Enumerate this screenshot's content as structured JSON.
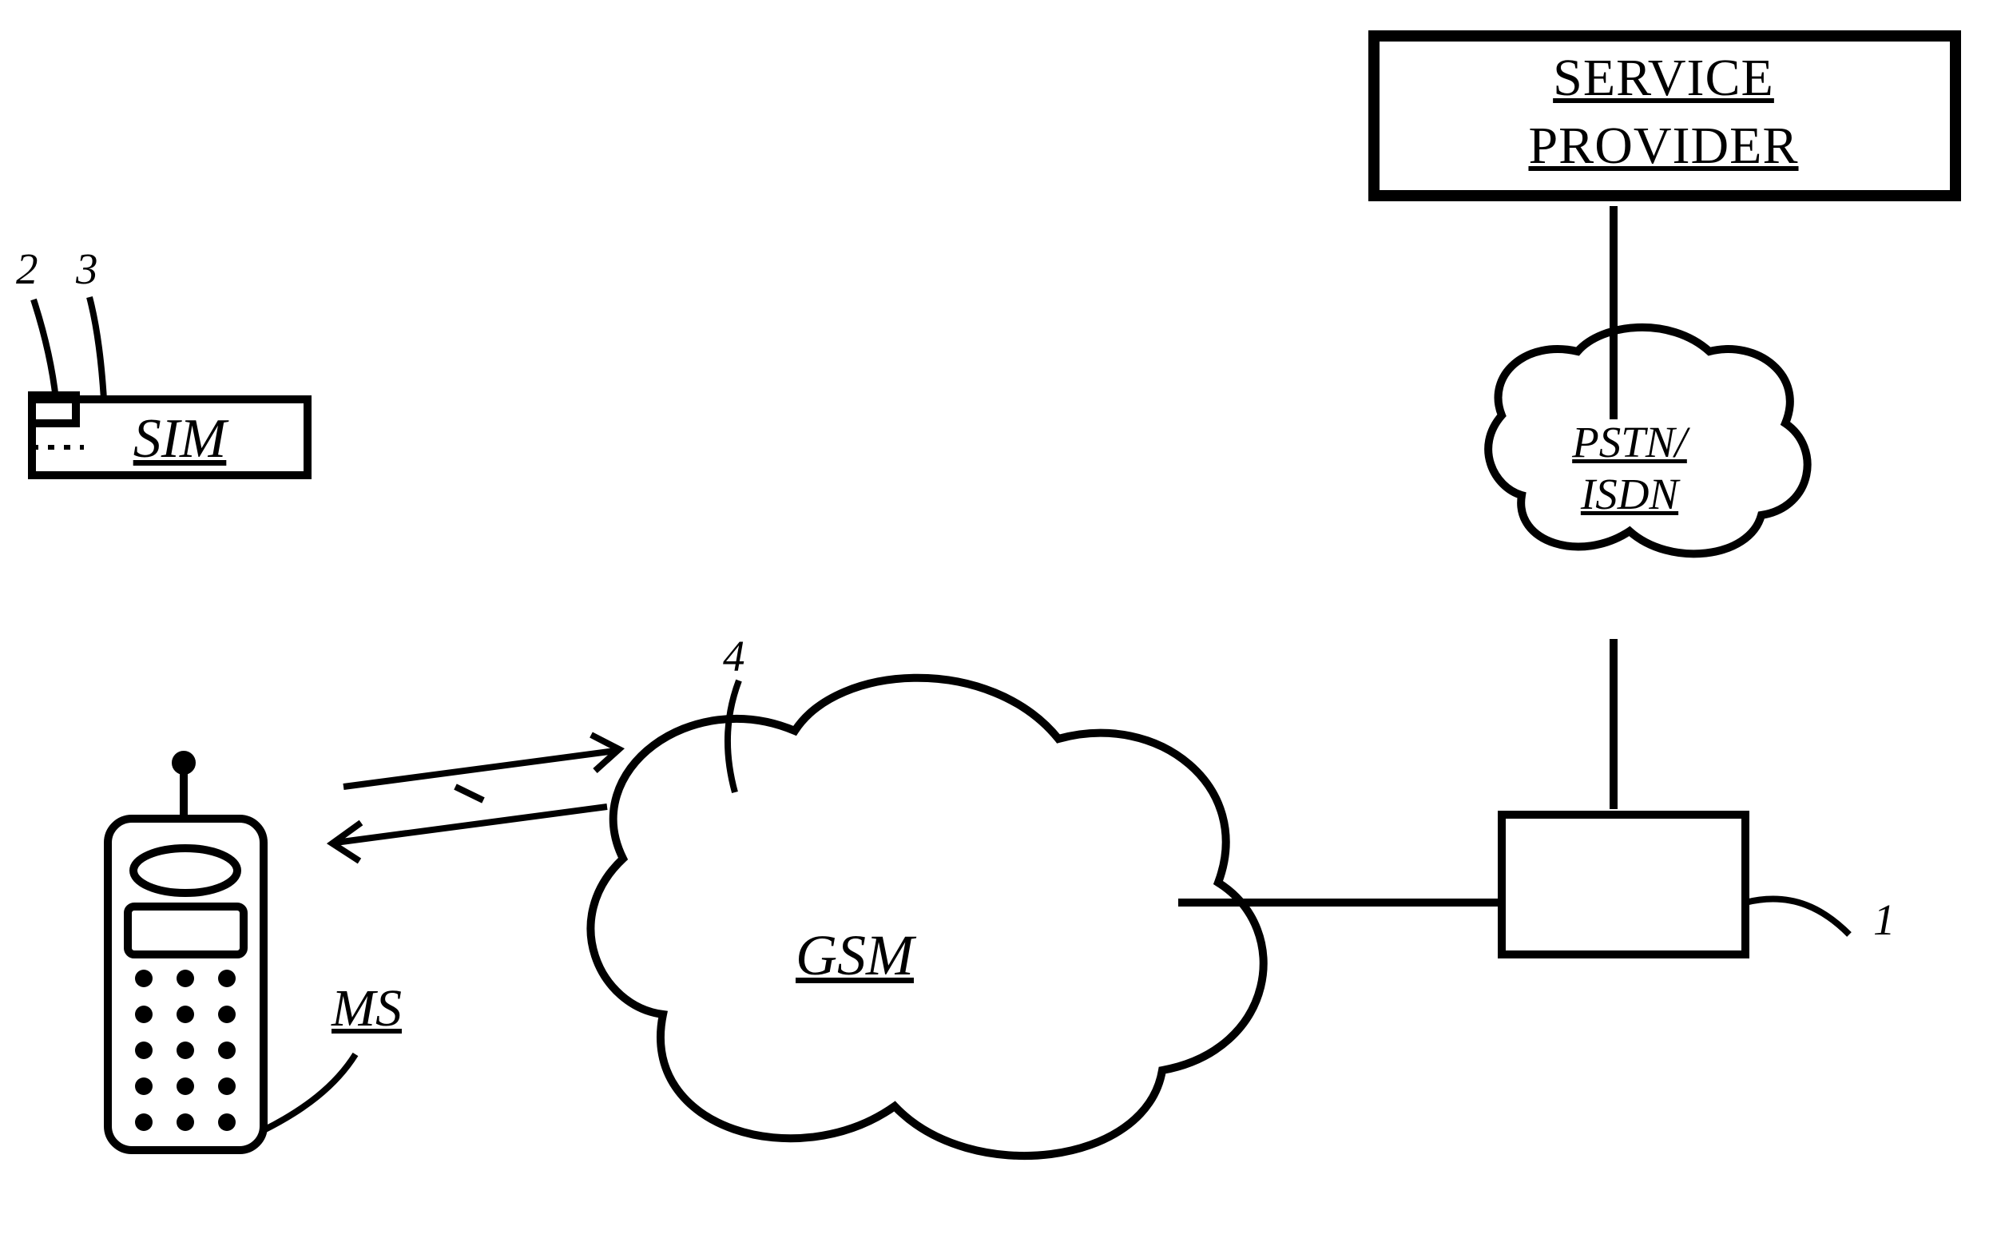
{
  "nodes": {
    "service_provider": {
      "line1": "SERVICE",
      "line2": "PROVIDER"
    },
    "sim": "SIM",
    "pstn_isdn": {
      "line1": "PSTN/",
      "line2": "ISDN"
    },
    "gsm": "GSM",
    "ms": "MS"
  },
  "labels": {
    "n1": "1",
    "n2": "2",
    "n3": "3",
    "n4": "4"
  }
}
